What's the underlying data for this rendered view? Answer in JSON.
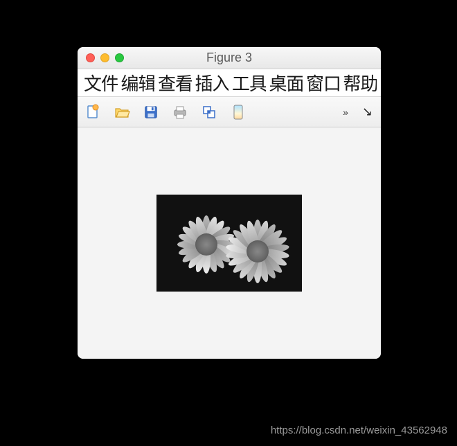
{
  "window": {
    "title": "Figure 3"
  },
  "menu": {
    "items": [
      "文件",
      "编辑",
      "查看",
      "插入",
      "工具",
      "桌面",
      "窗口",
      "帮助"
    ]
  },
  "toolbar": {
    "icons": [
      "new-file-icon",
      "open-file-icon",
      "save-icon",
      "print-icon",
      "link-icon",
      "device-icon"
    ],
    "overflow": "»",
    "dock": "↘"
  },
  "content": {
    "image_description": "grayscale photograph of two daisy-like flowers"
  },
  "watermark": "https://blog.csdn.net/weixin_43562948"
}
